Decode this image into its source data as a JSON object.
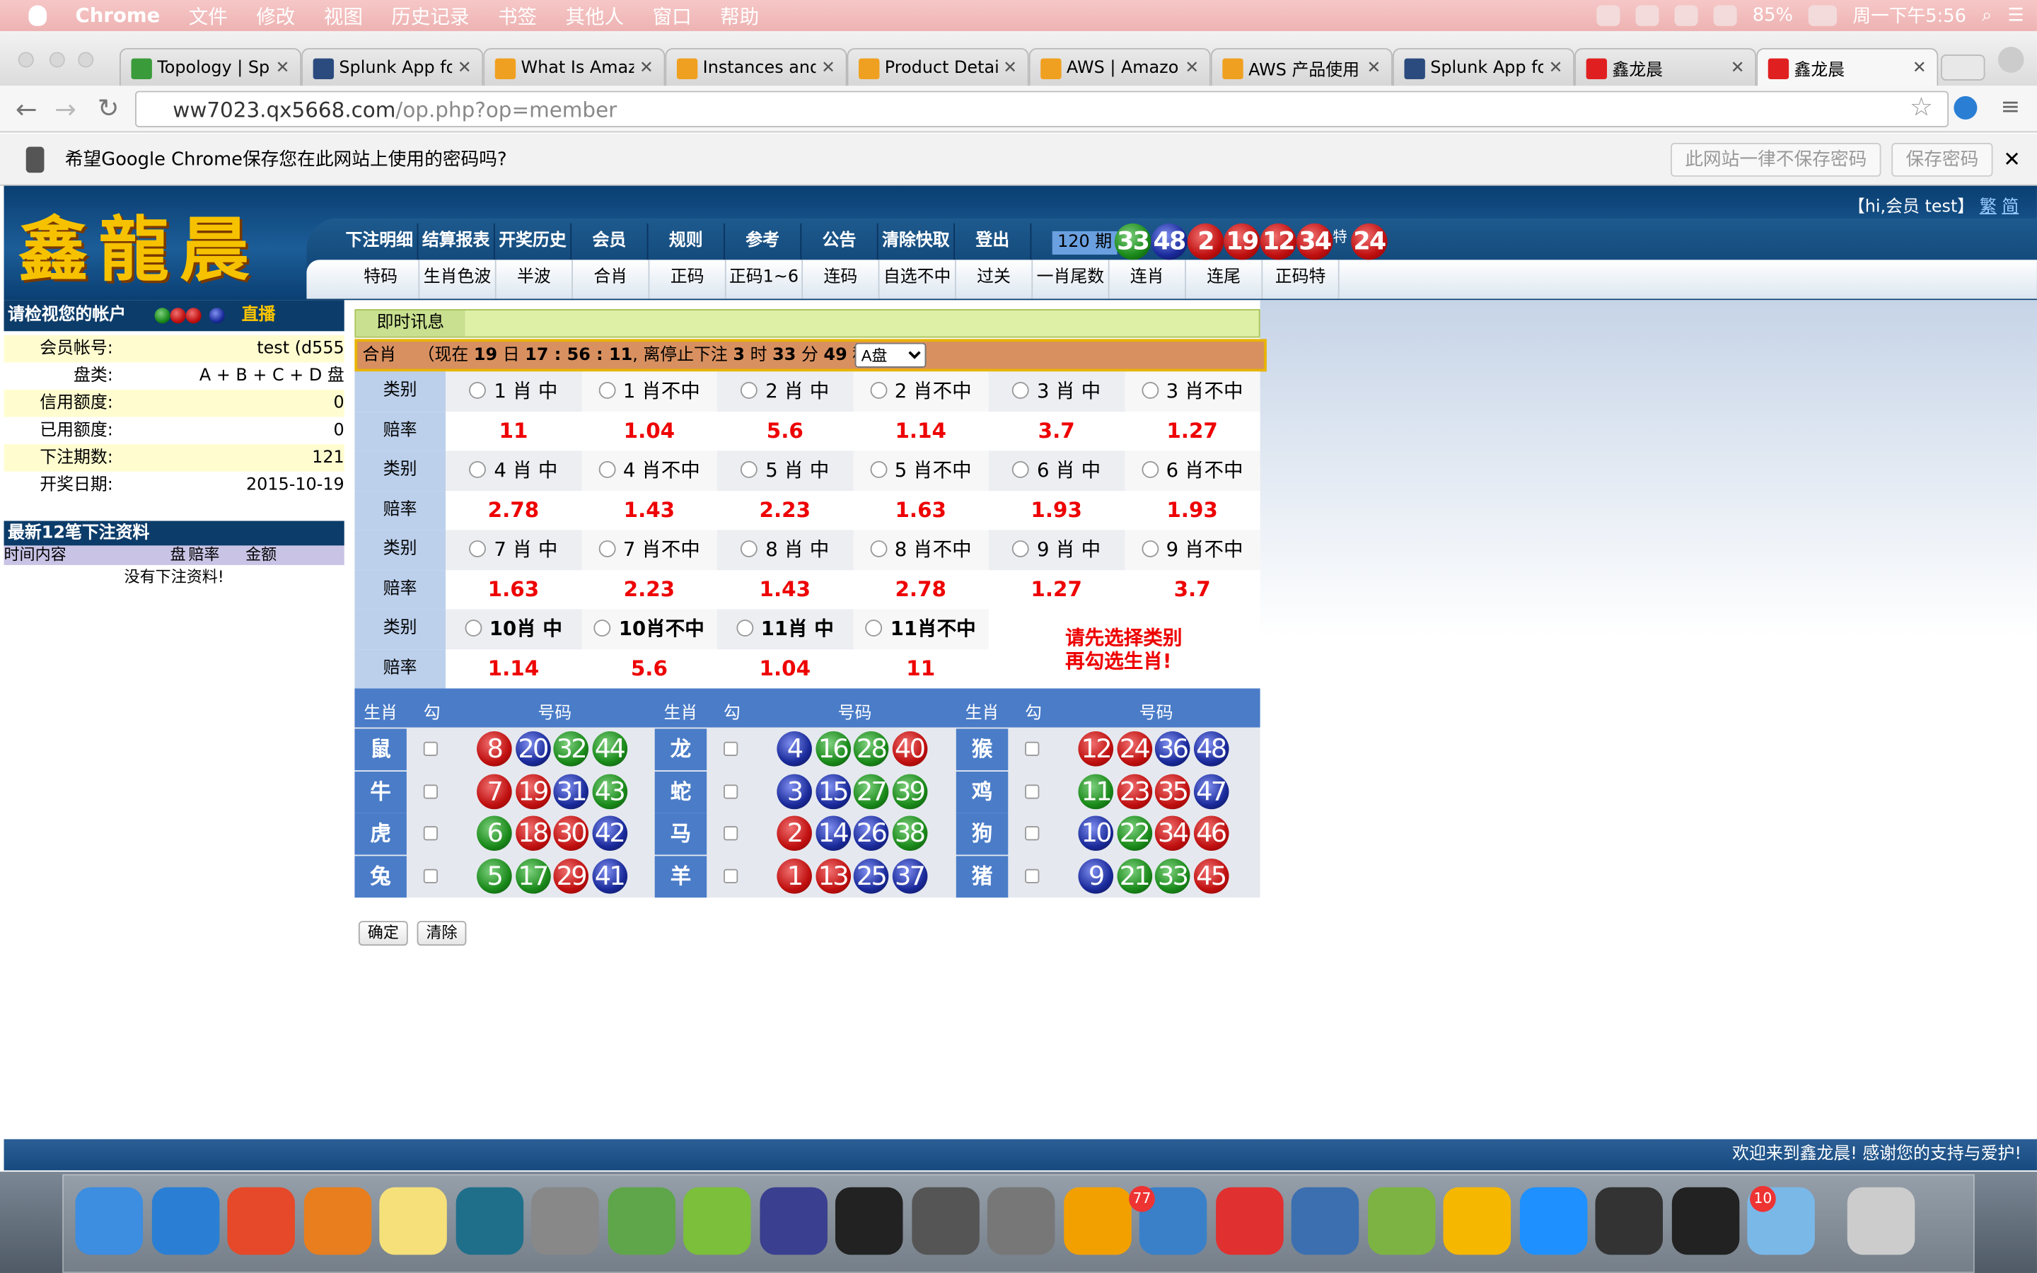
{
  "menubar": {
    "app": "Chrome",
    "items": [
      "文件",
      "修改",
      "视图",
      "历史记录",
      "书签",
      "其他人",
      "窗口",
      "帮助"
    ],
    "battery": "85%",
    "clock": "周一下午5:56"
  },
  "tabs": [
    {
      "label": "Topology | Splunk",
      "color": "#3a9b3a"
    },
    {
      "label": "Splunk App for AWS",
      "color": "#2b4b7e"
    },
    {
      "label": "What Is Amazon",
      "color": "#f0a020"
    },
    {
      "label": "Instances and",
      "color": "#f0a020"
    },
    {
      "label": "Product Details",
      "color": "#f0a020"
    },
    {
      "label": "AWS | Amazon",
      "color": "#f0a020"
    },
    {
      "label": "AWS 产品使用",
      "color": "#f0a020"
    },
    {
      "label": "Splunk App for AWS",
      "color": "#2b4b7e"
    },
    {
      "label": "鑫龙晨",
      "color": "#e02020"
    },
    {
      "label": "鑫龙晨",
      "color": "#e02020"
    }
  ],
  "url": {
    "host": "ww7023.qx5668.com",
    "path": "/op.php?op=member"
  },
  "password_bar": {
    "text": "希望Google Chrome保存您在此网站上使用的密码吗?",
    "never": "此网站一律不保存密码",
    "save": "保存密码"
  },
  "header": {
    "logo": "鑫龍晨",
    "greeting": "【hi,会员 test】",
    "trad": "繁",
    "simp": "简",
    "nav1": [
      "下注明细",
      "结算报表",
      "开奖历史",
      "会员",
      "规则",
      "参考",
      "公告",
      "清除快取",
      "登出"
    ],
    "nav2": [
      "特码",
      "生肖色波",
      "半波",
      "合肖",
      "正码",
      "正码1~6",
      "连码",
      "自选不中",
      "过关",
      "一肖尾数",
      "连肖",
      "连尾",
      "正码特"
    ],
    "period": "120 期",
    "special": "特",
    "balls": [
      {
        "n": "33",
        "c": "green"
      },
      {
        "n": "48",
        "c": "blue"
      },
      {
        "n": "2",
        "c": "red"
      },
      {
        "n": "19",
        "c": "red"
      },
      {
        "n": "12",
        "c": "red"
      },
      {
        "n": "34",
        "c": "red"
      },
      {
        "n": "24",
        "c": "red"
      }
    ]
  },
  "left": {
    "title": "请检视您的帐户",
    "live": "直播",
    "rows": [
      {
        "k": "会员帐号:",
        "v": "test (d555"
      },
      {
        "k": "盘类:",
        "v": "A + B + C + D 盘"
      },
      {
        "k": "信用额度:",
        "v": "0"
      },
      {
        "k": "已用额度:",
        "v": "0"
      },
      {
        "k": "下注期数:",
        "v": "121"
      },
      {
        "k": "开奖日期:",
        "v": "2015-10-19"
      }
    ],
    "last_title": "最新12笔下注资料",
    "cols": [
      "时间内容",
      "盘",
      "赔率",
      "金额"
    ],
    "nodata": "没有下注资料!"
  },
  "main": {
    "news": "即时讯息",
    "status_label": "合肖",
    "status_pre": "（现在",
    "day": "19",
    "day_unit": "日",
    "time": "17 : 56 : 11",
    "stop_pre": ", 离停止下注",
    "h": "3",
    "h_unit": "时",
    "m": "33",
    "m_unit": "分",
    "s": "49",
    "s_unit": "秒 ）",
    "select": "A盘",
    "cat_label": "类别",
    "odd_label": "赔率",
    "rows": [
      {
        "cats": [
          "1 肖 中",
          "1 肖不中",
          "2 肖 中",
          "2 肖不中",
          "3 肖 中",
          "3 肖不中"
        ],
        "odds": [
          "11",
          "1.04",
          "5.6",
          "1.14",
          "3.7",
          "1.27"
        ]
      },
      {
        "cats": [
          "4 肖 中",
          "4 肖不中",
          "5 肖 中",
          "5 肖不中",
          "6 肖 中",
          "6 肖不中"
        ],
        "odds": [
          "2.78",
          "1.43",
          "2.23",
          "1.63",
          "1.93",
          "1.93"
        ]
      },
      {
        "cats": [
          "7 肖 中",
          "7 肖不中",
          "8 肖 中",
          "8 肖不中",
          "9 肖 中",
          "9 肖不中"
        ],
        "odds": [
          "1.63",
          "2.23",
          "1.43",
          "2.78",
          "1.27",
          "3.7"
        ]
      },
      {
        "cats": [
          "10肖 中",
          "10肖不中",
          "11肖 中",
          "11肖不中"
        ],
        "odds": [
          "1.14",
          "5.6",
          "1.04",
          "11"
        ]
      }
    ],
    "hint1": "请先选择类别",
    "hint2": "再勾选生肖!",
    "zhd": {
      "zodiac": "生肖",
      "check": "勾",
      "nums": "号码"
    },
    "zodiac": [
      {
        "name": "鼠",
        "balls": [
          [
            "8",
            "red"
          ],
          [
            "20",
            "blue"
          ],
          [
            "32",
            "green"
          ],
          [
            "44",
            "green"
          ]
        ]
      },
      {
        "name": "牛",
        "balls": [
          [
            "7",
            "red"
          ],
          [
            "19",
            "red"
          ],
          [
            "31",
            "blue"
          ],
          [
            "43",
            "green"
          ]
        ]
      },
      {
        "name": "虎",
        "balls": [
          [
            "6",
            "green"
          ],
          [
            "18",
            "red"
          ],
          [
            "30",
            "red"
          ],
          [
            "42",
            "blue"
          ]
        ]
      },
      {
        "name": "兔",
        "balls": [
          [
            "5",
            "green"
          ],
          [
            "17",
            "green"
          ],
          [
            "29",
            "red"
          ],
          [
            "41",
            "blue"
          ]
        ]
      },
      {
        "name": "龙",
        "balls": [
          [
            "4",
            "blue"
          ],
          [
            "16",
            "green"
          ],
          [
            "28",
            "green"
          ],
          [
            "40",
            "red"
          ]
        ]
      },
      {
        "name": "蛇",
        "balls": [
          [
            "3",
            "blue"
          ],
          [
            "15",
            "blue"
          ],
          [
            "27",
            "green"
          ],
          [
            "39",
            "green"
          ]
        ]
      },
      {
        "name": "马",
        "balls": [
          [
            "2",
            "red"
          ],
          [
            "14",
            "blue"
          ],
          [
            "26",
            "blue"
          ],
          [
            "38",
            "green"
          ]
        ]
      },
      {
        "name": "羊",
        "balls": [
          [
            "1",
            "red"
          ],
          [
            "13",
            "red"
          ],
          [
            "25",
            "blue"
          ],
          [
            "37",
            "blue"
          ]
        ]
      },
      {
        "name": "猴",
        "balls": [
          [
            "12",
            "red"
          ],
          [
            "24",
            "red"
          ],
          [
            "36",
            "blue"
          ],
          [
            "48",
            "blue"
          ]
        ]
      },
      {
        "name": "鸡",
        "balls": [
          [
            "11",
            "green"
          ],
          [
            "23",
            "red"
          ],
          [
            "35",
            "red"
          ],
          [
            "47",
            "blue"
          ]
        ]
      },
      {
        "name": "狗",
        "balls": [
          [
            "10",
            "blue"
          ],
          [
            "22",
            "green"
          ],
          [
            "34",
            "red"
          ],
          [
            "46",
            "red"
          ]
        ]
      },
      {
        "name": "猪",
        "balls": [
          [
            "9",
            "blue"
          ],
          [
            "21",
            "green"
          ],
          [
            "33",
            "green"
          ],
          [
            "45",
            "red"
          ]
        ]
      }
    ],
    "confirm": "确定",
    "clear": "清除"
  },
  "footer": "欢迎来到鑫龙晨! 感谢您的支持与爱护!",
  "dock": {
    "badges": [
      "77",
      "10"
    ]
  }
}
